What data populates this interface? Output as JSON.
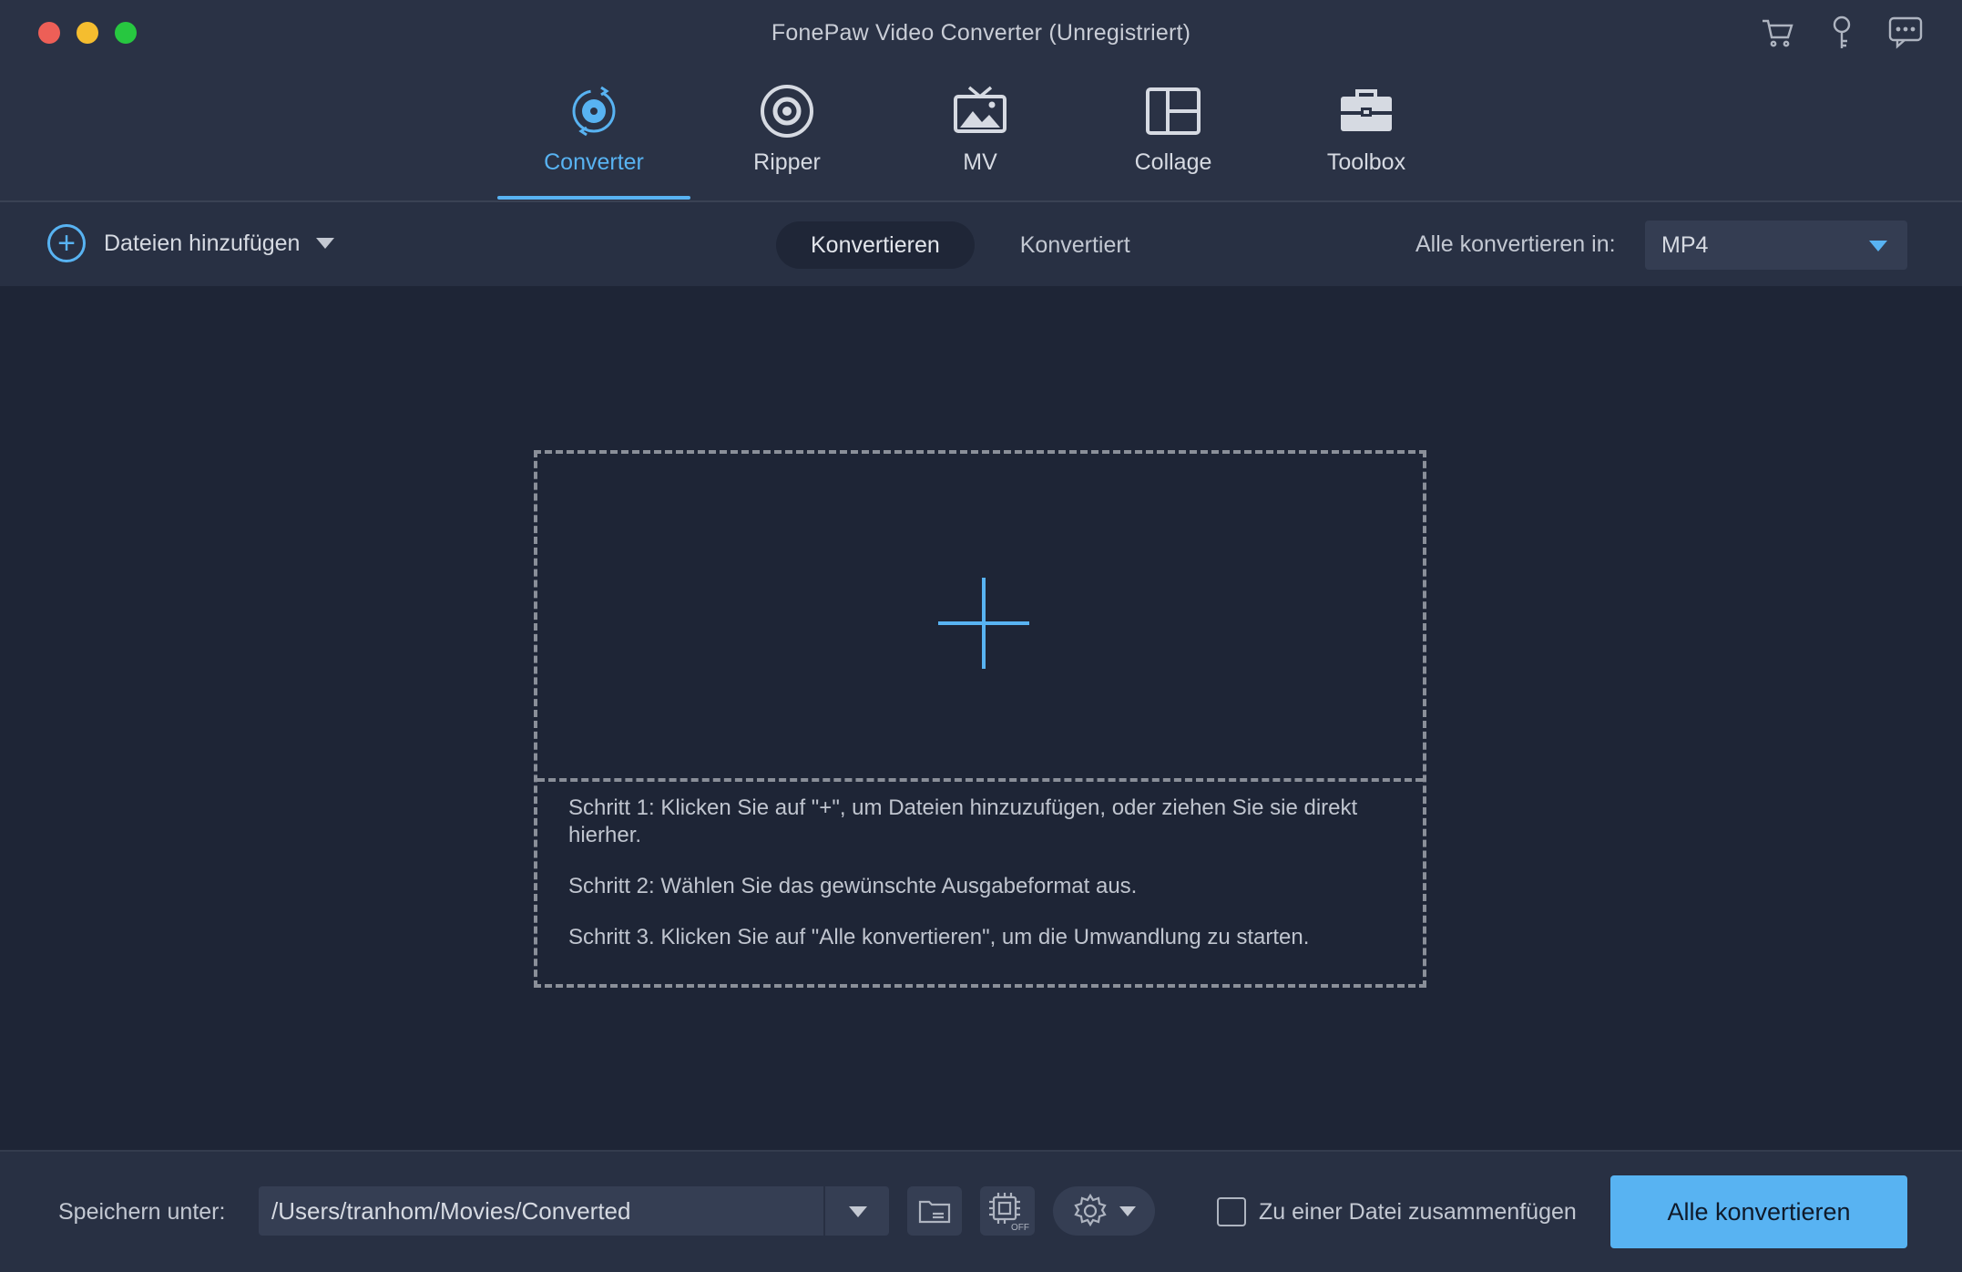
{
  "window": {
    "title": "FonePaw Video Converter (Unregistriert)",
    "top_icons": [
      "cart-icon",
      "key-icon",
      "chat-icon"
    ]
  },
  "nav": {
    "tabs": [
      {
        "label": "Converter",
        "icon": "converter-icon",
        "active": true
      },
      {
        "label": "Ripper",
        "icon": "ripper-icon",
        "active": false
      },
      {
        "label": "MV",
        "icon": "mv-icon",
        "active": false
      },
      {
        "label": "Collage",
        "icon": "collage-icon",
        "active": false
      },
      {
        "label": "Toolbox",
        "icon": "toolbox-icon",
        "active": false
      }
    ]
  },
  "toolbar": {
    "add_files": "Dateien hinzufügen",
    "segments": [
      "Konvertieren",
      "Konvertiert"
    ],
    "convert_all_label": "Alle konvertieren in:",
    "format": "MP4"
  },
  "dropzone": {
    "steps": [
      "Schritt 1: Klicken Sie auf \"+\", um Dateien hinzuzufügen, oder ziehen Sie sie direkt hierher.",
      "Schritt 2: Wählen Sie das gewünschte Ausgabeformat aus.",
      "Schritt 3. Klicken Sie auf \"Alle konvertieren\", um die Umwandlung zu starten."
    ]
  },
  "footer": {
    "save_label": "Speichern unter:",
    "path": "/Users/tranhom/Movies/Converted",
    "accel_badge": "OFF",
    "merge_label": "Zu einer Datei zusammenfügen",
    "merge_checked": false,
    "convert_all_button": "Alle konvertieren"
  },
  "colors": {
    "accent": "#58b3f2",
    "background": "#1e2536",
    "header": "#2a3245"
  }
}
